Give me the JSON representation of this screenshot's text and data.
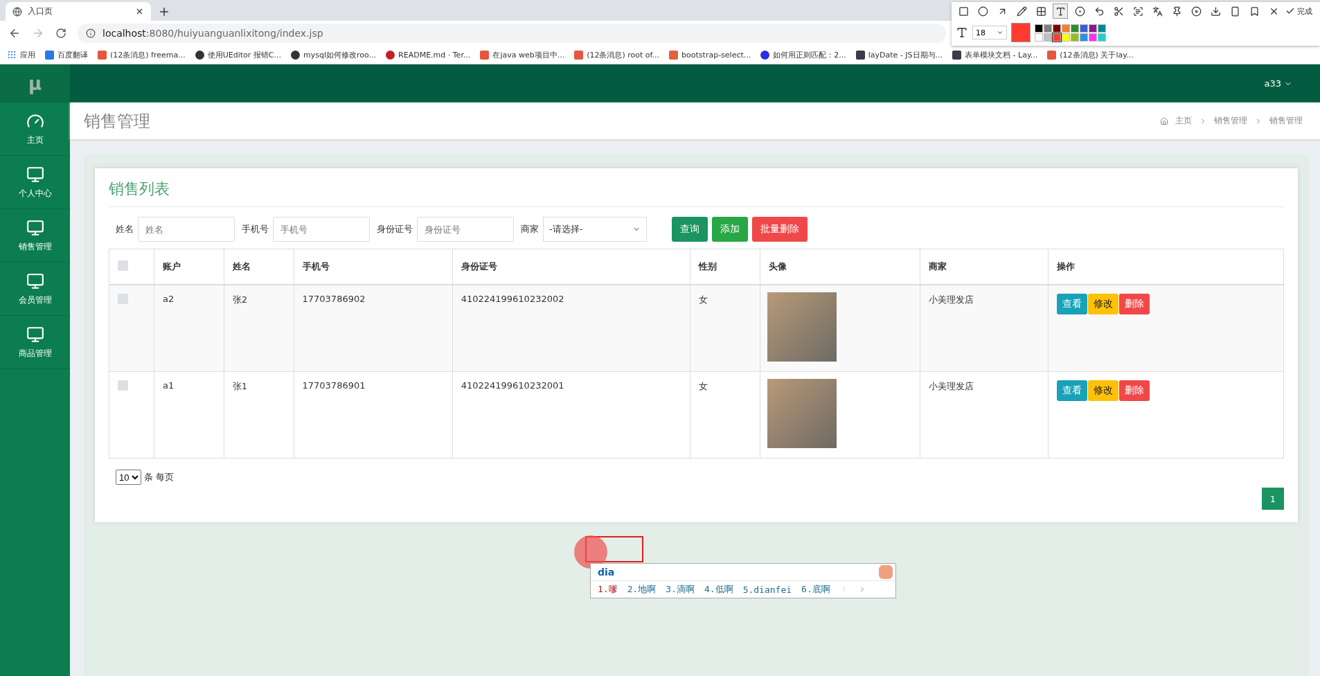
{
  "browser": {
    "tab_title": "入口页",
    "url_host": "localhost",
    "url_rest": ":8080/huiyuanguanlixitong/index.jsp",
    "bookmarks": [
      {
        "label": "应用",
        "kind": "apps",
        "color": "#4285f4"
      },
      {
        "label": "百度翻译",
        "kind": "square",
        "color": "#2a7ae2"
      },
      {
        "label": "(12条消息) freema...",
        "kind": "square",
        "color": "#e8553e"
      },
      {
        "label": "使用UEditor 报错C...",
        "kind": "swirl",
        "color": "#333333"
      },
      {
        "label": "mysql如何修改roo...",
        "kind": "swirl",
        "color": "#333333"
      },
      {
        "label": "README.md · Ter...",
        "kind": "circle",
        "color": "#c71d23"
      },
      {
        "label": "在java web项目中...",
        "kind": "square",
        "color": "#e8553e"
      },
      {
        "label": "(12条消息) root of...",
        "kind": "square",
        "color": "#e8553e"
      },
      {
        "label": "bootstrap-select...",
        "kind": "square",
        "color": "#e0623a"
      },
      {
        "label": "如何用正则匹配：2...",
        "kind": "circle",
        "color": "#2932e1"
      },
      {
        "label": "layDate - JS日期与...",
        "kind": "square",
        "color": "#393d49"
      },
      {
        "label": "表单模块文档 - Lay...",
        "kind": "square",
        "color": "#393d49"
      },
      {
        "label": "(12条消息) 关于lay...",
        "kind": "square",
        "color": "#e8553e"
      }
    ]
  },
  "app": {
    "logo": "μ",
    "user": "a33",
    "sidebar": {
      "items": [
        {
          "label": "主页",
          "kind": "gauge"
        },
        {
          "label": "个人中心",
          "kind": "monitor"
        },
        {
          "label": "销售管理",
          "kind": "monitor"
        },
        {
          "label": "会员管理",
          "kind": "monitor"
        },
        {
          "label": "商品管理",
          "kind": "monitor"
        }
      ]
    },
    "page_title": "销售管理",
    "breadcrumb": [
      "主页",
      "销售管理",
      "销售管理"
    ],
    "card_title": "销售列表",
    "filters": [
      {
        "label": "姓名",
        "kind": "input",
        "placeholder": "姓名"
      },
      {
        "label": "手机号",
        "kind": "input",
        "placeholder": "手机号"
      },
      {
        "label": "身份证号",
        "kind": "input",
        "placeholder": "身份证号"
      },
      {
        "label": "商家",
        "kind": "select",
        "value": "-请选择-"
      }
    ],
    "buttons": [
      {
        "label": "查询",
        "kind": "search"
      },
      {
        "label": "添加",
        "kind": "add"
      },
      {
        "label": "批量删除",
        "kind": "delete"
      }
    ],
    "table": {
      "header_checked": false,
      "columns": [
        "账户",
        "姓名",
        "手机号",
        "身份证号",
        "性别",
        "头像",
        "商家",
        "操作"
      ],
      "rows": [
        {
          "checked": false,
          "cells": [
            "a2",
            "张2",
            "17703786902",
            "410224199610232002",
            "女"
          ],
          "shop": "小美理发店",
          "actions": [
            {
              "label": "查看",
              "kind": "view"
            },
            {
              "label": "修改",
              "kind": "edit"
            },
            {
              "label": "删除",
              "kind": "delete"
            }
          ]
        },
        {
          "checked": false,
          "cells": [
            "a1",
            "张1",
            "17703786901",
            "410224199610232001",
            "女"
          ],
          "shop": "小美理发店",
          "actions": [
            {
              "label": "查看",
              "kind": "view"
            },
            {
              "label": "修改",
              "kind": "edit"
            },
            {
              "label": "删除",
              "kind": "delete"
            }
          ]
        }
      ]
    },
    "page_size": "10",
    "page_size_label": "条 每页",
    "pages": [
      {
        "label": "1",
        "selected": true
      }
    ]
  },
  "ime": {
    "input": "dia",
    "candidates": [
      {
        "label": "1.嗲",
        "selected": true
      },
      {
        "label": "2.地啊",
        "selected": false
      },
      {
        "label": "3.滴啊",
        "selected": false
      },
      {
        "label": "4.低啊",
        "selected": false
      },
      {
        "label": "5.dianfei",
        "selected": false
      },
      {
        "label": "6.底啊",
        "selected": false
      }
    ]
  },
  "capture_toolbar": {
    "tools": [
      {
        "kind": "rect",
        "selected": false
      },
      {
        "kind": "circle",
        "selected": false
      },
      {
        "kind": "arrow",
        "selected": false
      },
      {
        "kind": "pen",
        "selected": false
      },
      {
        "kind": "mosaic",
        "selected": false
      },
      {
        "kind": "text",
        "selected": true
      },
      {
        "kind": "number",
        "selected": false
      },
      {
        "kind": "undo",
        "selected": false
      },
      {
        "kind": "scissors",
        "selected": false
      },
      {
        "kind": "ocr",
        "selected": false
      },
      {
        "kind": "translate",
        "selected": false
      },
      {
        "kind": "pin",
        "selected": false
      },
      {
        "kind": "record",
        "selected": false
      },
      {
        "kind": "download",
        "selected": false
      },
      {
        "kind": "phone",
        "selected": false
      },
      {
        "kind": "bookmark",
        "selected": false
      },
      {
        "kind": "close",
        "selected": false
      }
    ],
    "done": "完成",
    "font_size": "18",
    "palette": [
      {
        "color": "#000000",
        "selected": false
      },
      {
        "color": "#808080",
        "selected": false
      },
      {
        "color": "#800000",
        "selected": false
      },
      {
        "color": "#f08030",
        "selected": false
      },
      {
        "color": "#2e8b2e",
        "selected": false
      },
      {
        "color": "#3a5fcd",
        "selected": false
      },
      {
        "color": "#8a1a8a",
        "selected": false
      },
      {
        "color": "#008b8b",
        "selected": false
      },
      {
        "color": "#ffffff",
        "selected": false
      },
      {
        "color": "#c0c0c0",
        "selected": false
      },
      {
        "color": "#ff3b30",
        "selected": true
      },
      {
        "color": "#ffff00",
        "selected": false
      },
      {
        "color": "#90c020",
        "selected": false
      },
      {
        "color": "#3090e0",
        "selected": false
      },
      {
        "color": "#ff30ff",
        "selected": false
      },
      {
        "color": "#20d0d0",
        "selected": false
      }
    ]
  }
}
